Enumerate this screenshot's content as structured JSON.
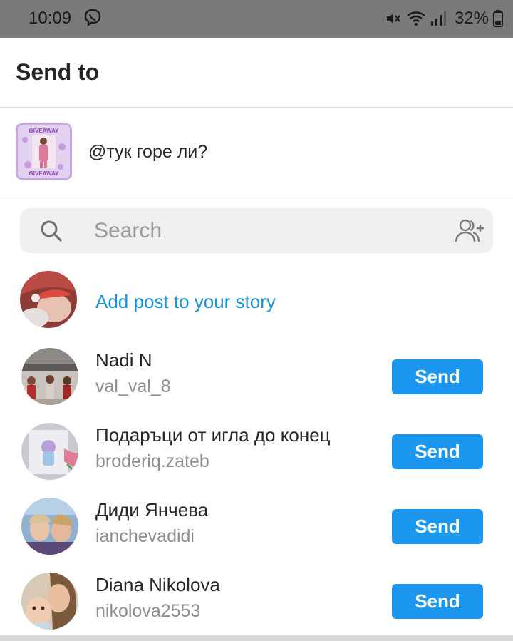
{
  "status_bar": {
    "time": "10:09",
    "battery": "32%",
    "icons": [
      "viber-icon",
      "mute-icon",
      "wifi-icon",
      "signal-icon",
      "battery-icon"
    ]
  },
  "sheet": {
    "title": "Send to"
  },
  "share_preview": {
    "caption": "@тук горе ли?",
    "thumb_banner": "GIVEAWAY"
  },
  "search": {
    "placeholder": "Search"
  },
  "story": {
    "label": "Add post to your story"
  },
  "contacts": [
    {
      "name": "Nadi N",
      "handle": "val_val_8",
      "button": "Send"
    },
    {
      "name": "Подаръци от игла до конец",
      "handle": "broderiq.zateb",
      "button": "Send"
    },
    {
      "name": "Диди Янчева",
      "handle": "ianchevadidi",
      "button": "Send"
    },
    {
      "name": "Diana Nikolova",
      "handle": "nikolova2553",
      "button": "Send"
    }
  ],
  "colors": {
    "accent": "#1b97f0",
    "link": "#1a94d8",
    "status_bar": "#7a7a7a",
    "muted_text": "#8e8e8e"
  }
}
